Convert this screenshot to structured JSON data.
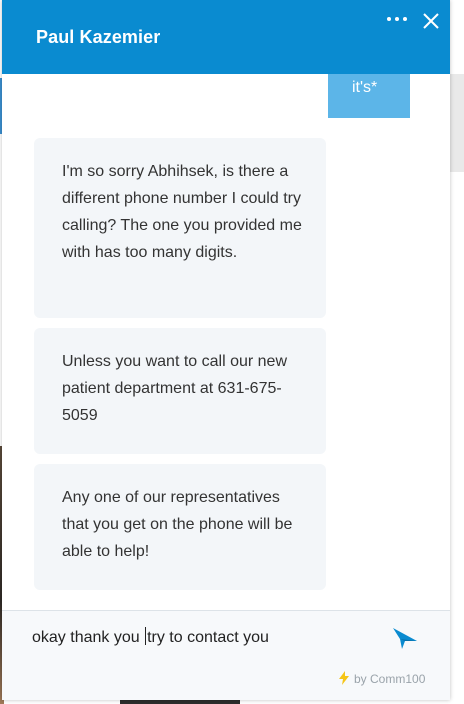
{
  "header": {
    "agent_name": "Paul Kazemier",
    "more_icon": "more-horizontal-icon",
    "close_icon": "close-icon",
    "color": "#0a8bd0"
  },
  "messages": {
    "outgoing_partial": "it's*",
    "incoming": [
      "I'm so sorry Abhihsek, is there a different phone number I could try calling? The one you provided me with has too many digits.",
      "Unless you want to call our new patient department at 631-675-5059",
      "Any one of our representatives that you get on the phone will be able to help!"
    ],
    "outgoing_color": "#5cb5e8",
    "incoming_color": "#f3f6f9"
  },
  "composer": {
    "value_before_caret": "okay thank you ",
    "value_after_caret": "try to contact you",
    "send_icon": "send-plane-icon",
    "powered_by": "by Comm100",
    "bolt_icon": "lightning-bolt-icon"
  }
}
